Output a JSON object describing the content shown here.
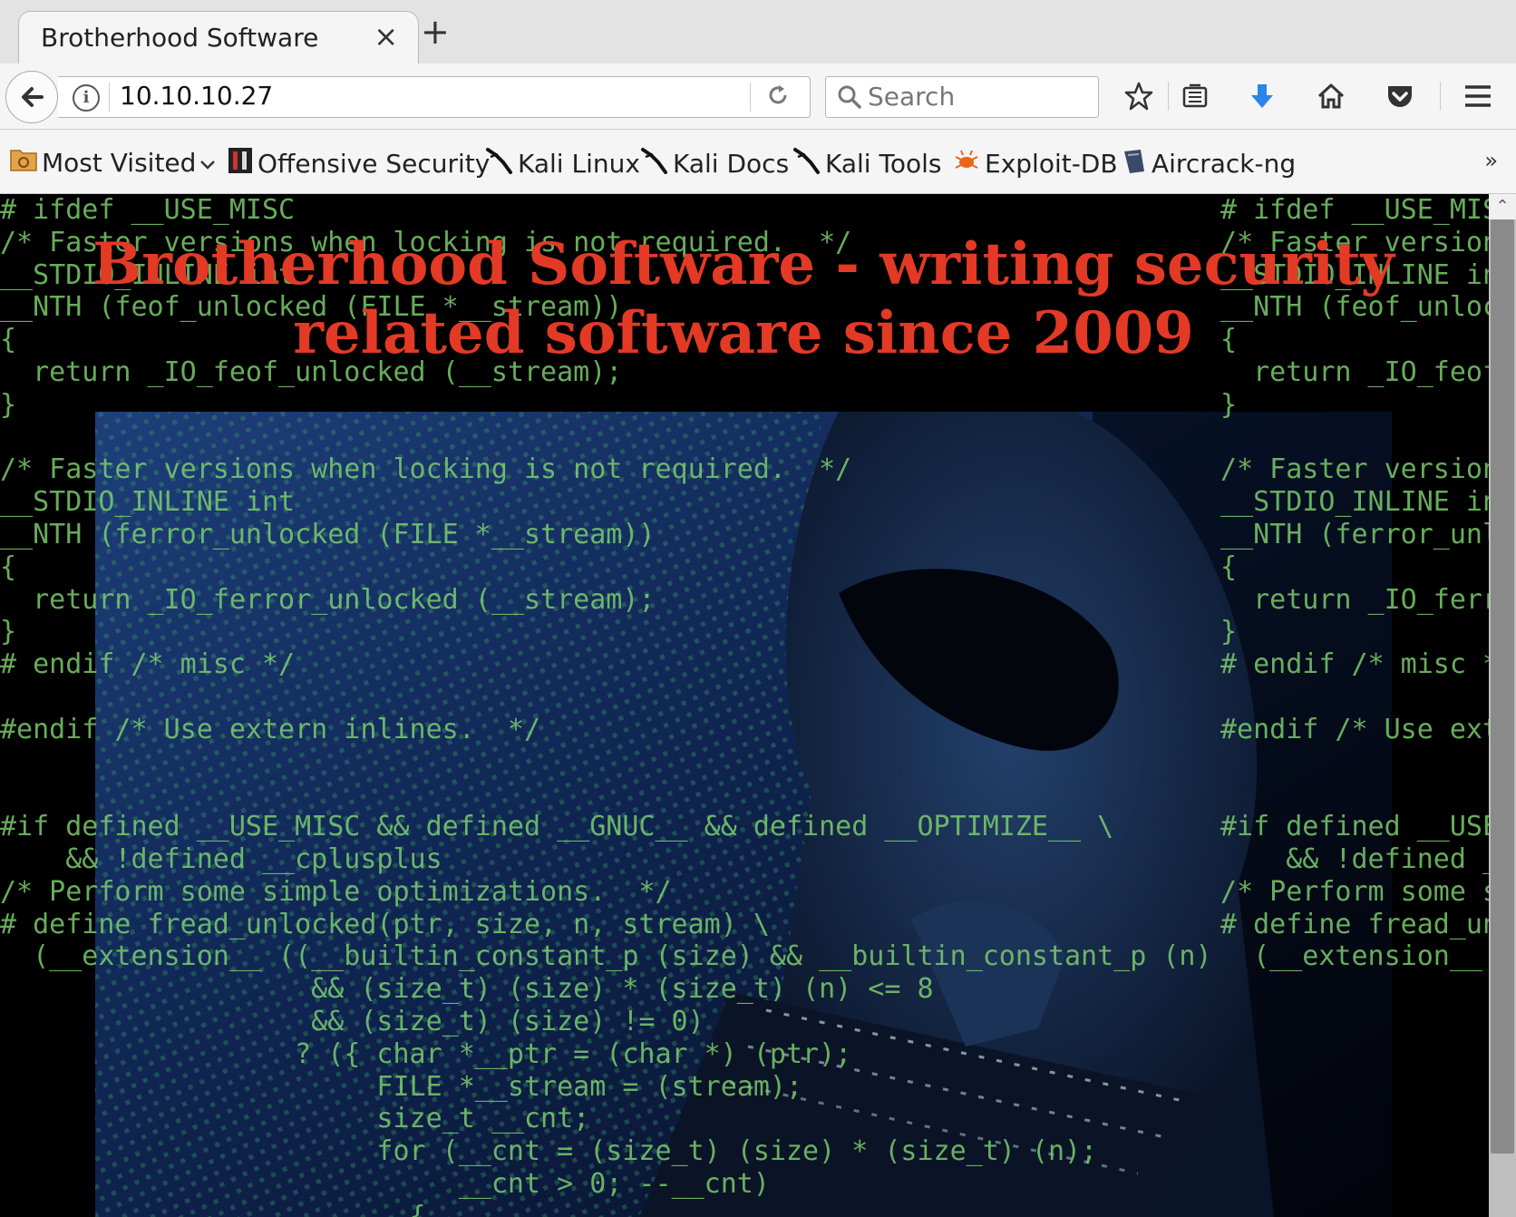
{
  "tab": {
    "title": "Brotherhood Software",
    "close": "×",
    "new_tab": "+"
  },
  "address_bar": {
    "url": "10.10.10.27"
  },
  "search": {
    "placeholder": "Search"
  },
  "bookmarks": [
    {
      "label": "Most Visited",
      "icon": "folder-icon",
      "has_dropdown": true
    },
    {
      "label": "Offensive Security",
      "icon": "offsec-icon"
    },
    {
      "label": "Kali Linux",
      "icon": "kali-dragon-icon"
    },
    {
      "label": "Kali Docs",
      "icon": "kali-dragon-icon"
    },
    {
      "label": "Kali Tools",
      "icon": "kali-dragon-icon"
    },
    {
      "label": "Exploit-DB",
      "icon": "bug-icon"
    },
    {
      "label": "Aircrack-ng",
      "icon": "aircrack-icon"
    }
  ],
  "bookmarks_overflow": "»",
  "page": {
    "headline": "Brotherhood Software - writing security related software since 2009",
    "code_left": "# ifdef __USE_MISC\n/* Faster versions when locking is not required.  */\n__STDIO_INLINE int\n__NTH (feof_unlocked (FILE *__stream))\n{\n  return _IO_feof_unlocked (__stream);\n}\n\n/* Faster versions when locking is not required.  */\n__STDIO_INLINE int\n__NTH (ferror_unlocked (FILE *__stream))\n{\n  return _IO_ferror_unlocked (__stream);\n}\n# endif /* misc */\n\n#endif /* Use extern inlines.  */\n\n\n#if defined __USE_MISC && defined __GNUC__ && defined __OPTIMIZE__ \\\n    && !defined __cplusplus\n/* Perform some simple optimizations.  */\n# define fread_unlocked(ptr, size, n, stream) \\\n  (__extension__ ((__builtin_constant_p (size) && __builtin_constant_p (n)\n                   && (size_t) (size) * (size_t) (n) <= 8\n                   && (size_t) (size) != 0)\n                  ? ({ char *__ptr = (char *) (ptr);\n                       FILE *__stream = (stream);\n                       size_t __cnt;\n                       for (__cnt = (size_t) (size) * (size_t) (n);\n                            __cnt > 0; --__cnt)\n                         {",
    "code_right": "# ifdef __USE_MIS\n/* Faster version\n__STDIO_INLINE in\n__NTH (feof_unloc\n{\n  return _IO_feof\n}\n\n/* Faster version\n__STDIO_INLINE in\n__NTH (ferror_unl\n{\n  return _IO_ferr\n}\n# endif /* misc *\n\n#endif /* Use ext\n\n\n#if defined __USE\n    && !defined _\n/* Perform some s\n# define fread_un\n  (__extension__ "
  }
}
